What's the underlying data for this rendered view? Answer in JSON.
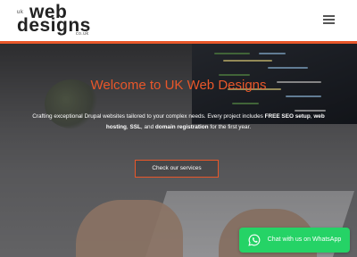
{
  "header": {
    "logo": {
      "prefix": "uk",
      "line1": "web",
      "line2": "designs",
      "domain": "co.uk"
    },
    "menu_icon": "hamburger-menu-icon"
  },
  "hero": {
    "title": "Welcome to UK Web Designs",
    "description_parts": {
      "p1": "Crafting exceptional Drupal websites tailored to your complex needs. Every project includes ",
      "b1": "FREE SEO setup",
      "p2": ", ",
      "b2": "web hosting",
      "p3": ", ",
      "b3": "SSL",
      "p4": ", and ",
      "b4": "domain registration",
      "p5": " for the first year."
    },
    "cta_label": "Check our services"
  },
  "whatsapp": {
    "label": "Chat with us on WhatsApp",
    "icon": "whatsapp-icon"
  },
  "colors": {
    "accent": "#e8572a",
    "whatsapp": "#25d366"
  }
}
